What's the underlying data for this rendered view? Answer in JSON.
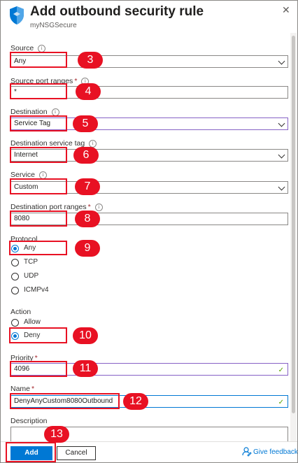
{
  "header": {
    "title": "Add outbound security rule",
    "subtitle": "myNSGSecure",
    "close_glyph": "✕"
  },
  "fields": {
    "source": {
      "label": "Source",
      "value": "Any"
    },
    "source_port_ranges": {
      "label": "Source port ranges",
      "value": "*"
    },
    "destination": {
      "label": "Destination",
      "value": "Service Tag"
    },
    "destination_service_tag": {
      "label": "Destination service tag",
      "value": "Internet"
    },
    "service": {
      "label": "Service",
      "value": "Custom"
    },
    "destination_port_ranges": {
      "label": "Destination port ranges",
      "value": "8080"
    },
    "protocol": {
      "label": "Protocol",
      "options": [
        "Any",
        "TCP",
        "UDP",
        "ICMPv4"
      ],
      "selected": "Any"
    },
    "action": {
      "label": "Action",
      "options": [
        "Allow",
        "Deny"
      ],
      "selected": "Deny"
    },
    "priority": {
      "label": "Priority",
      "value": "4096"
    },
    "name": {
      "label": "Name",
      "value": "DenyAnyCustom8080Outbound"
    },
    "description": {
      "label": "Description",
      "value": ""
    }
  },
  "required_mark": "*",
  "info_glyph": "i",
  "valid_glyph": "✓",
  "callouts": [
    "3",
    "4",
    "5",
    "6",
    "7",
    "8",
    "9",
    "10",
    "11",
    "12",
    "13"
  ],
  "footer": {
    "add_label": "Add",
    "cancel_label": "Cancel",
    "feedback_label": "Give feedback"
  },
  "colors": {
    "accent": "#0078d4",
    "callout": "#e81123",
    "focus_border": "#8661c5",
    "valid": "#57a300",
    "required": "#a4262c"
  },
  "icons": [
    "shield-icon",
    "close-icon",
    "info-icon",
    "chevron-down-icon",
    "checkmark-icon",
    "feedback-icon"
  ]
}
